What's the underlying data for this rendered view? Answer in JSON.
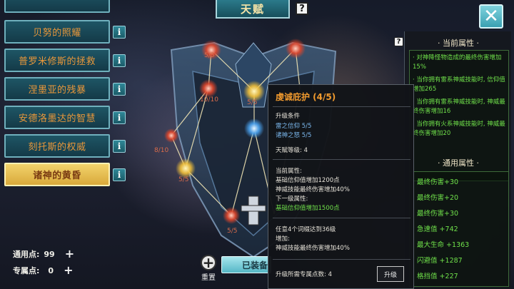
{
  "header": {
    "title": "天赋"
  },
  "talents": [
    {
      "label": "贝努的照耀"
    },
    {
      "label": "普罗米修斯的拯救"
    },
    {
      "label": "涅墨亚的残暴"
    },
    {
      "label": "安德洛墨达的智慧"
    },
    {
      "label": "刻托斯的权威"
    },
    {
      "label": "诸神的黄昏",
      "selected": true
    }
  ],
  "info_label": "i",
  "help_label": "?",
  "close_label": "✕",
  "points": {
    "general_label": "通用点:",
    "general_value": "99",
    "exclusive_label": "专属点:",
    "exclusive_value": "0",
    "plus": "+"
  },
  "tree": {
    "node_labels": [
      "5/5",
      "10/10",
      "5/5",
      "8/10",
      "5/5",
      "5/5"
    ]
  },
  "tooltip": {
    "title": "虔诚庇护 (4/5)",
    "req_header": "升级条件",
    "req_1": "雷之信仰  5/5",
    "req_2": "诸神之怒  5/5",
    "talent_level": "天赋等级: 4",
    "current_header": "当前属性:",
    "current_1": "基础信仰值增加1200点",
    "current_2": "神威技能最终伤害增加40%",
    "next_header": "下一级属性:",
    "next_1": "基础信仰值增加1500点",
    "cond_1": "任意4个词缀达到36级",
    "cond_2": "增加:",
    "cond_3": "神威技能最终伤害增加40%",
    "cost": "升级所需专属点数: 4",
    "upgrade_label": "升级"
  },
  "attributes": {
    "current_header": "· 当前属性 ·",
    "current_items": [
      "· 对神降怪物造成的最终伤害增加15%",
      "· 当你拥有雷系神威技能时, 信仰值增加265",
      "· 当你拥有雷系神威技能时, 神威最终伤害增加16",
      "· 当你拥有火系神威技能时, 神威最终伤害增加20"
    ],
    "general_header": "· 通用属性 ·",
    "general_items": [
      "· 最终伤害+30",
      "· 最终伤害+20",
      "· 最终伤害+30",
      "· 急速值 +742",
      "· 最大生命 +1363",
      "· 闪避值 +1287",
      "· 格挡值 +227"
    ]
  },
  "bottom": {
    "reset_label": "重置",
    "reset_symbol": "+",
    "equipped_label": "已装备"
  },
  "colors": {
    "accent_orange": "#e8973a",
    "teal": "#1e5565",
    "selected_gold": "#f2d36c",
    "attribute_green": "#6fe04a"
  }
}
